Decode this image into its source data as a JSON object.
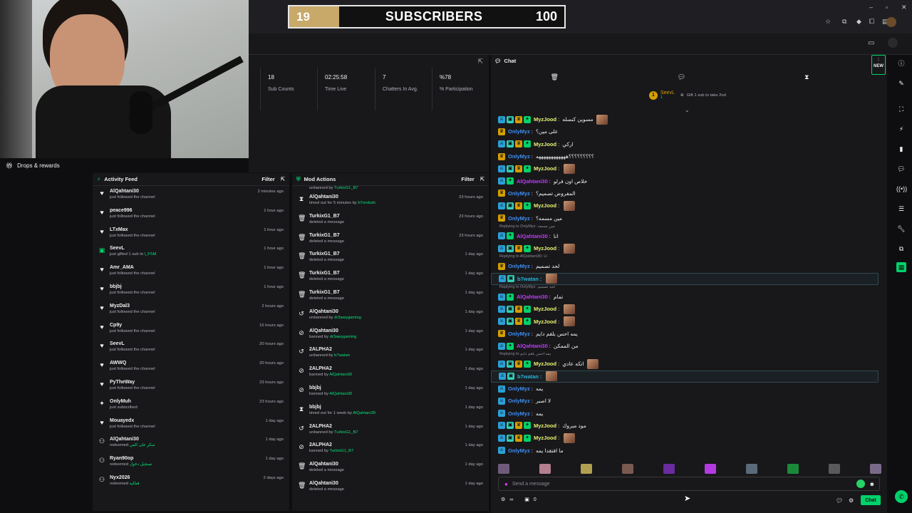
{
  "overlay": {
    "sub_current": "19",
    "sub_label": "SUBSCRIBERS",
    "sub_goal": "100",
    "sub_progress": 0.19
  },
  "drops": {
    "label": "Drops & rewards"
  },
  "stats": [
    {
      "value": "18",
      "label": "Sub Counts"
    },
    {
      "value": "02:25:58",
      "label": "Time Live"
    },
    {
      "value": "7",
      "label": "Chatters In Avg."
    },
    {
      "value": "%78",
      "label": "% Participation"
    }
  ],
  "activity": {
    "title": "Activity Feed",
    "filter": "Filter",
    "items": [
      {
        "name": "AlQahtani30",
        "sub": "just followed the channel",
        "time": "2 minutes ago",
        "icon": "heart-icon"
      },
      {
        "name": "peace996",
        "sub": "just followed the channel",
        "time": "1 hour ago",
        "icon": "heart-icon"
      },
      {
        "name": "LTxMax",
        "sub": "just followed the channel",
        "time": "1 hour ago",
        "icon": "heart-icon"
      },
      {
        "name": "SeevL",
        "sub": "just gifted 1 sub to",
        "sub_hl": "l_FSM",
        "time": "1 hour ago",
        "icon": "gift-icon"
      },
      {
        "name": "Amr_AMA",
        "sub": "just followed the channel",
        "time": "1 hour ago",
        "icon": "heart-icon"
      },
      {
        "name": "bbjbj",
        "sub": "just followed the channel",
        "time": "1 hour ago",
        "icon": "heart-icon"
      },
      {
        "name": "MyzDal3",
        "sub": "just followed the channel",
        "time": "2 hours ago",
        "icon": "heart-icon"
      },
      {
        "name": "Cp9y",
        "sub": "just followed the channel",
        "time": "15 hours ago",
        "icon": "heart-icon"
      },
      {
        "name": "SeevL",
        "sub": "just followed the channel",
        "time": "20 hours ago",
        "icon": "heart-icon"
      },
      {
        "name": "AWWQ",
        "sub": "just followed the channel",
        "time": "20 hours ago",
        "icon": "heart-icon"
      },
      {
        "name": "PyTheWay",
        "sub": "just followed the channel",
        "time": "23 hours ago",
        "icon": "heart-icon"
      },
      {
        "name": "OnlyMuh",
        "sub": "just subscribed",
        "time": "23 hours ago",
        "icon": "star-icon"
      },
      {
        "name": "Mouayedx",
        "sub": "just followed the channel",
        "time": "1 day ago",
        "icon": "heart-icon"
      },
      {
        "name": "AlQahtani30",
        "sub": "redeemed",
        "sub_hl": "سكر على الفي",
        "time": "1 day ago",
        "icon": "channel-points-icon"
      },
      {
        "name": "Ryan90op",
        "sub": "redeemed",
        "sub_hl": "تسجيل دخول",
        "time": "1 day ago",
        "icon": "channel-points-icon"
      },
      {
        "name": "Nyx2026",
        "sub": "redeemed",
        "sub_hl": "فعاليه",
        "time": "2 days ago",
        "icon": "channel-points-icon"
      }
    ]
  },
  "mod": {
    "title": "Mod Actions",
    "filter": "Filter",
    "top_partial": {
      "sub": "unbanned by",
      "by": "TurkixG1_B7"
    },
    "items": [
      {
        "name": "AlQahtani30",
        "sub": "timed out for 5 minutes by",
        "by": "b7orobah",
        "time": "23 hours ago",
        "icon": "hourglass-icon"
      },
      {
        "name": "TurkixG1_B7",
        "sub": "deleted a message",
        "by": "",
        "time": "23 hours ago",
        "icon": "trash-icon"
      },
      {
        "name": "TurkixG1_B7",
        "sub": "deleted a message",
        "by": "",
        "time": "23 hours ago",
        "icon": "trash-icon"
      },
      {
        "name": "TurkixG1_B7",
        "sub": "deleted a message",
        "by": "",
        "time": "1 day ago",
        "icon": "trash-icon"
      },
      {
        "name": "TurkixG1_B7",
        "sub": "deleted a message",
        "by": "",
        "time": "1 day ago",
        "icon": "trash-icon"
      },
      {
        "name": "TurkixG1_B7",
        "sub": "deleted a message",
        "by": "",
        "time": "1 day ago",
        "icon": "trash-icon"
      },
      {
        "name": "AlQahtani30",
        "sub": "unbanned by",
        "by": "dr3awygaming",
        "time": "1 day ago",
        "icon": "undo-icon"
      },
      {
        "name": "AlQahtani30",
        "sub": "banned by",
        "by": "dr3awygaming",
        "time": "1 day ago",
        "icon": "ban-icon"
      },
      {
        "name": "2ALPHA2",
        "sub": "unbanned by",
        "by": "b7watan",
        "time": "1 day ago",
        "icon": "undo-icon"
      },
      {
        "name": "2ALPHA2",
        "sub": "banned by",
        "by": "AlQahtani30",
        "time": "1 day ago",
        "icon": "ban-icon"
      },
      {
        "name": "bbjbj",
        "sub": "banned by",
        "by": "AlQahtani30",
        "time": "1 day ago",
        "icon": "ban-icon"
      },
      {
        "name": "bbjbj",
        "sub": "timed out for 1 week by",
        "by": "AlQahtani30",
        "time": "1 day ago",
        "icon": "hourglass-icon"
      },
      {
        "name": "2ALPHA2",
        "sub": "unbanned by",
        "by": "TurkixG1_B7",
        "time": "1 day ago",
        "icon": "undo-icon"
      },
      {
        "name": "2ALPHA2",
        "sub": "banned by",
        "by": "TurkixG1_B7",
        "time": "1 day ago",
        "icon": "ban-icon"
      },
      {
        "name": "AlQahtani30",
        "sub": "deleted a message",
        "by": "",
        "time": "1 day ago",
        "icon": "trash-icon"
      },
      {
        "name": "AlQahtani30",
        "sub": "deleted a message",
        "by": "",
        "time": "1 day ago",
        "icon": "trash-icon"
      }
    ]
  },
  "chat": {
    "title": "Chat",
    "new_label": "NEW",
    "gift": {
      "rank": "1",
      "user": "SeevL",
      "count": "1",
      "cta": "Gift 1 sub to take 2nd"
    },
    "messages": [
      {
        "user": "MyzJood",
        "color": "#e6f26f",
        "text": "مسوين كنسله",
        "badges": [
          "blue",
          "teal",
          "gold",
          "green"
        ],
        "emote": true
      },
      {
        "user": "OnlyMyz",
        "color": "#3d8ef7",
        "text": "على مين؟",
        "badges": [
          "gold"
        ]
      },
      {
        "user": "MyzJood",
        "color": "#e6f26f",
        "text": "اركي",
        "badges": [
          "blue",
          "teal",
          "gold",
          "green"
        ]
      },
      {
        "user": "OnlyMyz",
        "color": "#3d8ef7",
        "text": "؟؟؟؟؟؟؟؟؟ههههههههههههه",
        "badges": [
          "gold"
        ]
      },
      {
        "user": "MyzJood",
        "color": "#e6f26f",
        "text": "",
        "badges": [
          "blue",
          "teal",
          "gold",
          "green"
        ],
        "emote": true
      },
      {
        "user": "AlQahtani30",
        "color": "#b93ff0",
        "text": "خلاص اون فرلو",
        "badges": [
          "blue",
          "green"
        ]
      },
      {
        "user": "OnlyMyz",
        "color": "#3d8ef7",
        "text": "المفروض تصميم؟",
        "badges": [
          "gold"
        ]
      },
      {
        "user": "MyzJood",
        "color": "#e6f26f",
        "text": "",
        "badges": [
          "blue",
          "teal",
          "gold",
          "green"
        ],
        "emote": true
      },
      {
        "user": "OnlyMyz",
        "color": "#3d8ef7",
        "text": "مين مسمه؟",
        "badges": [
          "gold"
        ]
      },
      {
        "reply": "Replying to OnlyMyz: مين مسمه",
        "user": "AlQahtani30",
        "color": "#b93ff0",
        "text": "انا",
        "badges": [
          "blue",
          "green"
        ]
      },
      {
        "user": "MyzJood",
        "color": "#e6f26f",
        "text": "",
        "badges": [
          "blue",
          "teal",
          "gold",
          "green"
        ],
        "emote": true
      },
      {
        "reply": "Replying to AlQahtani30: انا",
        "user": "OnlyMyz",
        "color": "#3d8ef7",
        "text": "لحد تصميم",
        "badges": [
          "gold"
        ]
      },
      {
        "user": "b7watan",
        "color": "#2ab0d6",
        "text": "",
        "badges": [
          "blue",
          "teal"
        ],
        "emote": true,
        "hl": true
      },
      {
        "reply": "Replying to OnlyMyz: لحد تصميم",
        "user": "AlQahtani30",
        "color": "#b93ff0",
        "text": "تمام",
        "badges": [
          "blue",
          "green"
        ]
      },
      {
        "user": "MyzJood",
        "color": "#e6f26f",
        "text": "",
        "badges": [
          "blue",
          "teal",
          "gold",
          "green"
        ],
        "emote": true
      },
      {
        "user": "MyzJood",
        "color": "#e6f26f",
        "text": "",
        "badges": [
          "blue",
          "teal",
          "gold",
          "green"
        ],
        "emote": true
      },
      {
        "user": "OnlyMyz",
        "color": "#3d8ef7",
        "text": "يمه احس بلقم دايم",
        "badges": [
          "gold"
        ]
      },
      {
        "user": "AlQahtani30",
        "color": "#b93ff0",
        "text": "من الممكن",
        "badges": [
          "blue",
          "green"
        ]
      },
      {
        "reply": "Replying to يمه احس بلقم دايم",
        "user": "MyzJood",
        "color": "#e6f26f",
        "text": "اتكه عادي",
        "badges": [
          "blue",
          "teal",
          "gold",
          "green"
        ],
        "emote": true
      },
      {
        "user": "b7watan",
        "color": "#2ab0d6",
        "text": "",
        "badges": [
          "blue",
          "teal"
        ],
        "emote": true,
        "hl": true
      },
      {
        "user": "OnlyMyz",
        "color": "#3d8ef7",
        "text": "يمه",
        "badges": [
          "blue"
        ]
      },
      {
        "user": "OnlyMyz",
        "color": "#3d8ef7",
        "text": "لا اصبر",
        "badges": [
          "blue"
        ]
      },
      {
        "user": "OnlyMyz",
        "color": "#3d8ef7",
        "text": "يمه",
        "badges": [
          "blue"
        ]
      },
      {
        "user": "MyzJood",
        "color": "#e6f26f",
        "text": "مود مبروك",
        "badges": [
          "blue",
          "teal",
          "gold",
          "green"
        ]
      },
      {
        "user": "MyzJood",
        "color": "#e6f26f",
        "text": "",
        "badges": [
          "blue",
          "teal",
          "gold",
          "green"
        ],
        "emote": true
      },
      {
        "user": "OnlyMyz",
        "color": "#3d8ef7",
        "text": "ما افتقدا يمه",
        "badges": [
          "blue"
        ]
      }
    ],
    "input_placeholder": "Send a message",
    "points": "0",
    "chat_button": "Chat"
  },
  "colors": {
    "accent": "#00d26a",
    "bg": "#0e0e10",
    "panel": "#18181b"
  }
}
